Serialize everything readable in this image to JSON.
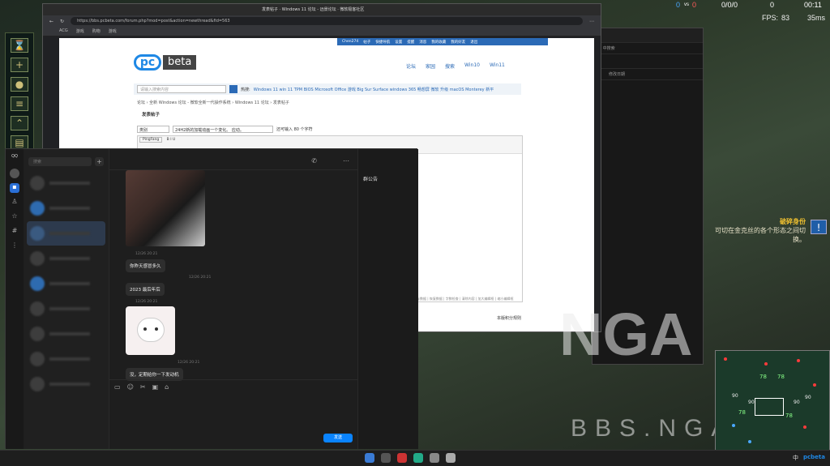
{
  "game": {
    "score_left": "0",
    "vs_label": "vs",
    "score_right": "0",
    "kda": "0/0/0",
    "cs": "0",
    "time": "00:11",
    "fps_label": "FPS:",
    "fps_value": "83",
    "ping": "35ms"
  },
  "browser": {
    "tab_title": "发表帖子 · Windows 11 论坛 - 远景论坛 · 微软极客社区",
    "url": "https://bbs.pcbeta.com/forum.php?mod=post&action=newthread&fid=563",
    "bookmarks": [
      "ACG",
      "游戏",
      "购物",
      "游戏"
    ]
  },
  "page": {
    "topnav": [
      "Chen274",
      "帖子",
      "快捷导航",
      "设置",
      "提醒",
      "消息",
      "我的收藏",
      "我的好友",
      "退出"
    ],
    "logo_pc": "pc",
    "logo_beta": "beta",
    "sitenav": [
      "论坛",
      "家园",
      "搜索",
      "Win10",
      "Win11"
    ],
    "search_placeholder": "请输入搜索内容",
    "hot_label": "热搜:",
    "hot_terms": "Windows 11 win 11 TPM BIOS Microsoft Office 游戏 Big Sur Surface windows 365 畅想屏 微软 升级 macOS Monterey 新平",
    "breadcrumb": "论坛 › 全新 Windows 论坛 - 微软全新一代操作系统 › Windows 11 论坛 › 发表帖子",
    "title": "发表帖子",
    "type_select": "类别",
    "subject_value": "24H2新的加载动画一个变化。 应动。",
    "char_hint": "还可输入 80 个字符",
    "font_select": "PingFang",
    "editor_footer": "保存数据 | 恢复数据 | 字数检查 | 清除内容 | 加大编辑框 | 缩小编辑框",
    "rules": "本版积分规则"
  },
  "bg_window": {
    "search_hint": "站 中搜索",
    "col_header": "修改日期"
  },
  "qq": {
    "brand": "QQ",
    "search_placeholder": "搜索",
    "plus": "+",
    "group_notice": "群公告",
    "messages": [
      {
        "time": "12/26 20:21",
        "text": "你昨天感冒多久"
      },
      {
        "time": "12/26 20:21",
        "text": "2023 最后年后"
      },
      {
        "time": "12/26 20:21",
        "text": "sticker"
      },
      {
        "time": "12/26 20:21",
        "text": "没，定期给你一下发动机"
      }
    ],
    "send_label": "发送"
  },
  "notice": {
    "title": "破碎身份",
    "body": "可切在金克丝的各个形态之间切换。",
    "icon": "!"
  },
  "watermark": {
    "big": "NGA",
    "small": "BBS.NGA.CN"
  },
  "minimap_counts": [
    "78",
    "78",
    "78",
    "78",
    "90",
    "90",
    "90",
    "90"
  ],
  "taskbar": {
    "ime": "中",
    "tray_brand": "pcbeta"
  }
}
